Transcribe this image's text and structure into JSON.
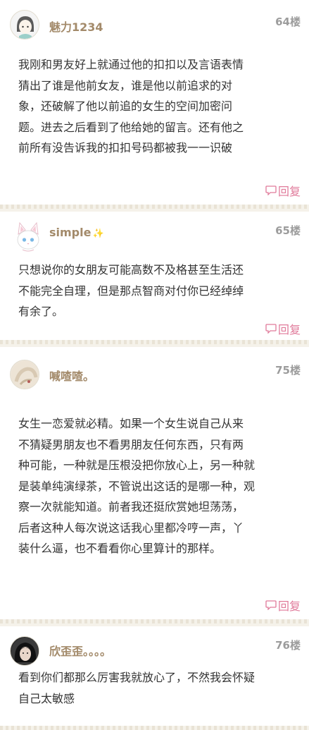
{
  "posts": [
    {
      "author": "魅力1234",
      "floor": "64楼",
      "lines": [
        "我刚和男友好上就通过他的扣扣以及言语表情",
        "猜出了谁是他前女友，谁是他以前追求的对",
        "象，还破解了他以前追的女生的空间加密问",
        "题。进去之后看到了他给她的留言。还有他之",
        "前所有没告诉我的扣扣号码都被我一一识破"
      ],
      "reply": "回复"
    },
    {
      "author": "simple",
      "floor": "65楼",
      "lines": [
        "只想说你的女朋友可能高数不及格甚至生活还",
        "不能完全自理，但是那点智商对付你已经绰绰",
        "有余了。"
      ],
      "reply": "回复"
    },
    {
      "author": "喊喳喳。",
      "floor": "75楼",
      "lines": [
        "女生一恋爱就必精。如果一个女生说自己从来",
        "不猜疑男朋友也不看男朋友任何东西，只有两",
        "种可能，一种就是压根没把你放心上，另一种就",
        "是装单纯演绿茶，不管说出这话的是哪一种，观",
        "察一次就能知道。前者我还挺欣赏她坦荡荡，",
        "后者这种人每次说这话我心里都冷哼一声，丫",
        "装什么逼，也不看看你心里算计的那样。"
      ],
      "reply": "回复"
    },
    {
      "author": "欣歪歪。。。。",
      "floor": "76楼",
      "lines": [
        "看到你们都那么厉害我就放心了，不然我会怀疑",
        "自己太敏感"
      ]
    }
  ],
  "colors": {
    "author": "#a38a6a",
    "reply": "#e07a9a",
    "floor": "#9c9c9c",
    "text": "#333333"
  },
  "icons": {
    "reply": "speech-bubble-icon",
    "sparkle": "sparkle-icon"
  }
}
